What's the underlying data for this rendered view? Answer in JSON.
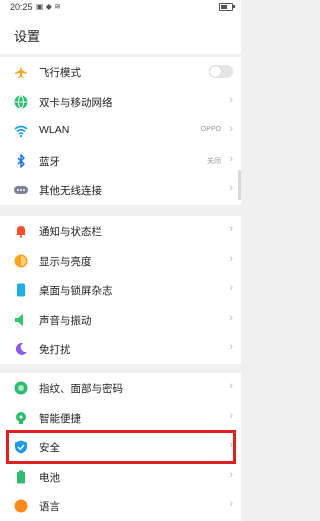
{
  "status_bar": {
    "time": "20:25",
    "icons": "▣ ◆ ≋"
  },
  "header": {
    "title": "设置"
  },
  "groups": [
    {
      "items": [
        {
          "label": "飞行模式",
          "control": "toggle",
          "toggle_on": false,
          "icon": "airplane-icon",
          "color": "#f5a623"
        },
        {
          "label": "双卡与移动网络",
          "control": "chevron",
          "icon": "globe-icon",
          "color": "#2dbd6e"
        },
        {
          "label": "WLAN",
          "value": "OPPO",
          "control": "chevron",
          "icon": "wifi-icon",
          "color": "#1aa0e8"
        },
        {
          "label": "蓝牙",
          "value": "关闭",
          "control": "chevron",
          "icon": "bluetooth-icon",
          "color": "#1a73e8"
        },
        {
          "label": "其他无线连接",
          "control": "chevron",
          "icon": "more-icon",
          "color": "#7b8494"
        }
      ]
    },
    {
      "items": [
        {
          "label": "通知与状态栏",
          "control": "chevron",
          "icon": "bell-icon",
          "color": "#ff4d2e"
        },
        {
          "label": "显示与亮度",
          "control": "chevron",
          "icon": "brightness-icon",
          "color": "#ffa31a"
        },
        {
          "label": "桌面与锁屏杂志",
          "control": "chevron",
          "icon": "phone-icon",
          "color": "#1ab0e8"
        },
        {
          "label": "声音与振动",
          "control": "chevron",
          "icon": "speaker-icon",
          "color": "#2cc76e"
        },
        {
          "label": "免打扰",
          "control": "chevron",
          "icon": "moon-icon",
          "color": "#8a5cf0"
        }
      ]
    },
    {
      "items": [
        {
          "label": "指纹、面部与密码",
          "control": "chevron",
          "icon": "fingerprint-icon",
          "color": "#2dbd6e"
        },
        {
          "label": "智能便捷",
          "control": "chevron",
          "icon": "bulb-icon",
          "color": "#2dbd6e"
        },
        {
          "label": "安全",
          "control": "chevron",
          "icon": "shield-icon",
          "color": "#1a9be8"
        },
        {
          "label": "电池",
          "control": "chevron",
          "icon": "battery-icon",
          "color": "#2dbd6e"
        },
        {
          "label": "语言",
          "control": "chevron",
          "icon": "language-icon",
          "color": "#ff8a1a"
        }
      ]
    }
  ],
  "chevron_glyph": "›"
}
